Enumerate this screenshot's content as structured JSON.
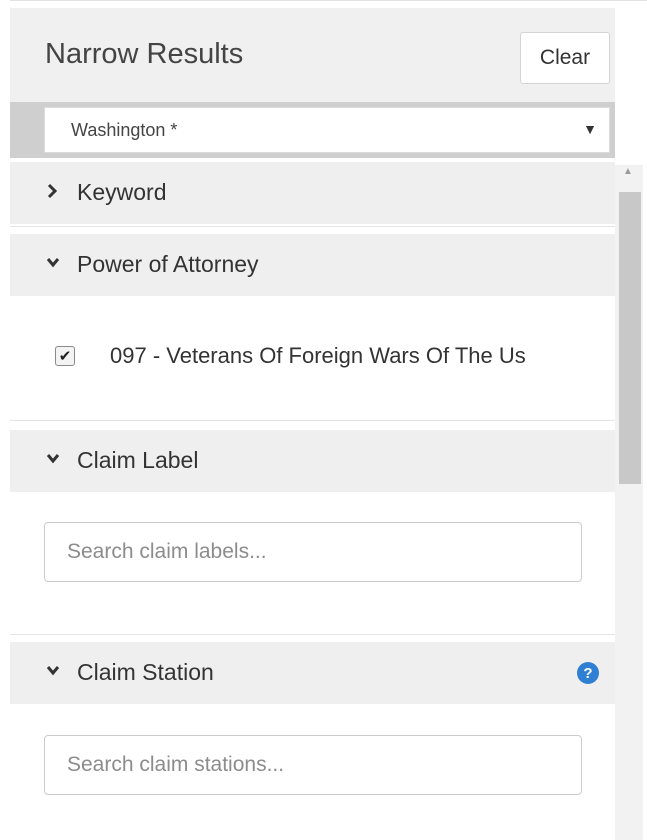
{
  "panel": {
    "title": "Narrow Results",
    "clear_label": "Clear"
  },
  "location_select": {
    "value": "Washington *",
    "arrow": "▼"
  },
  "sections": {
    "keyword": {
      "label": "Keyword",
      "expanded": false
    },
    "power_of_attorney": {
      "label": "Power of Attorney",
      "expanded": true,
      "options": [
        {
          "label": "097 - Veterans Of Foreign Wars Of The Us",
          "checked": true
        }
      ]
    },
    "claim_label": {
      "label": "Claim Label",
      "expanded": true,
      "search_placeholder": "Search claim labels..."
    },
    "claim_station": {
      "label": "Claim Station",
      "expanded": true,
      "help_icon": "?",
      "search_placeholder": "Search claim stations..."
    }
  },
  "icons": {
    "expanded_chevron": "chevron-down-icon",
    "collapsed_chevron": "chevron-right-icon",
    "help": "help-circle-icon",
    "help_color": "#2f7fd2"
  }
}
